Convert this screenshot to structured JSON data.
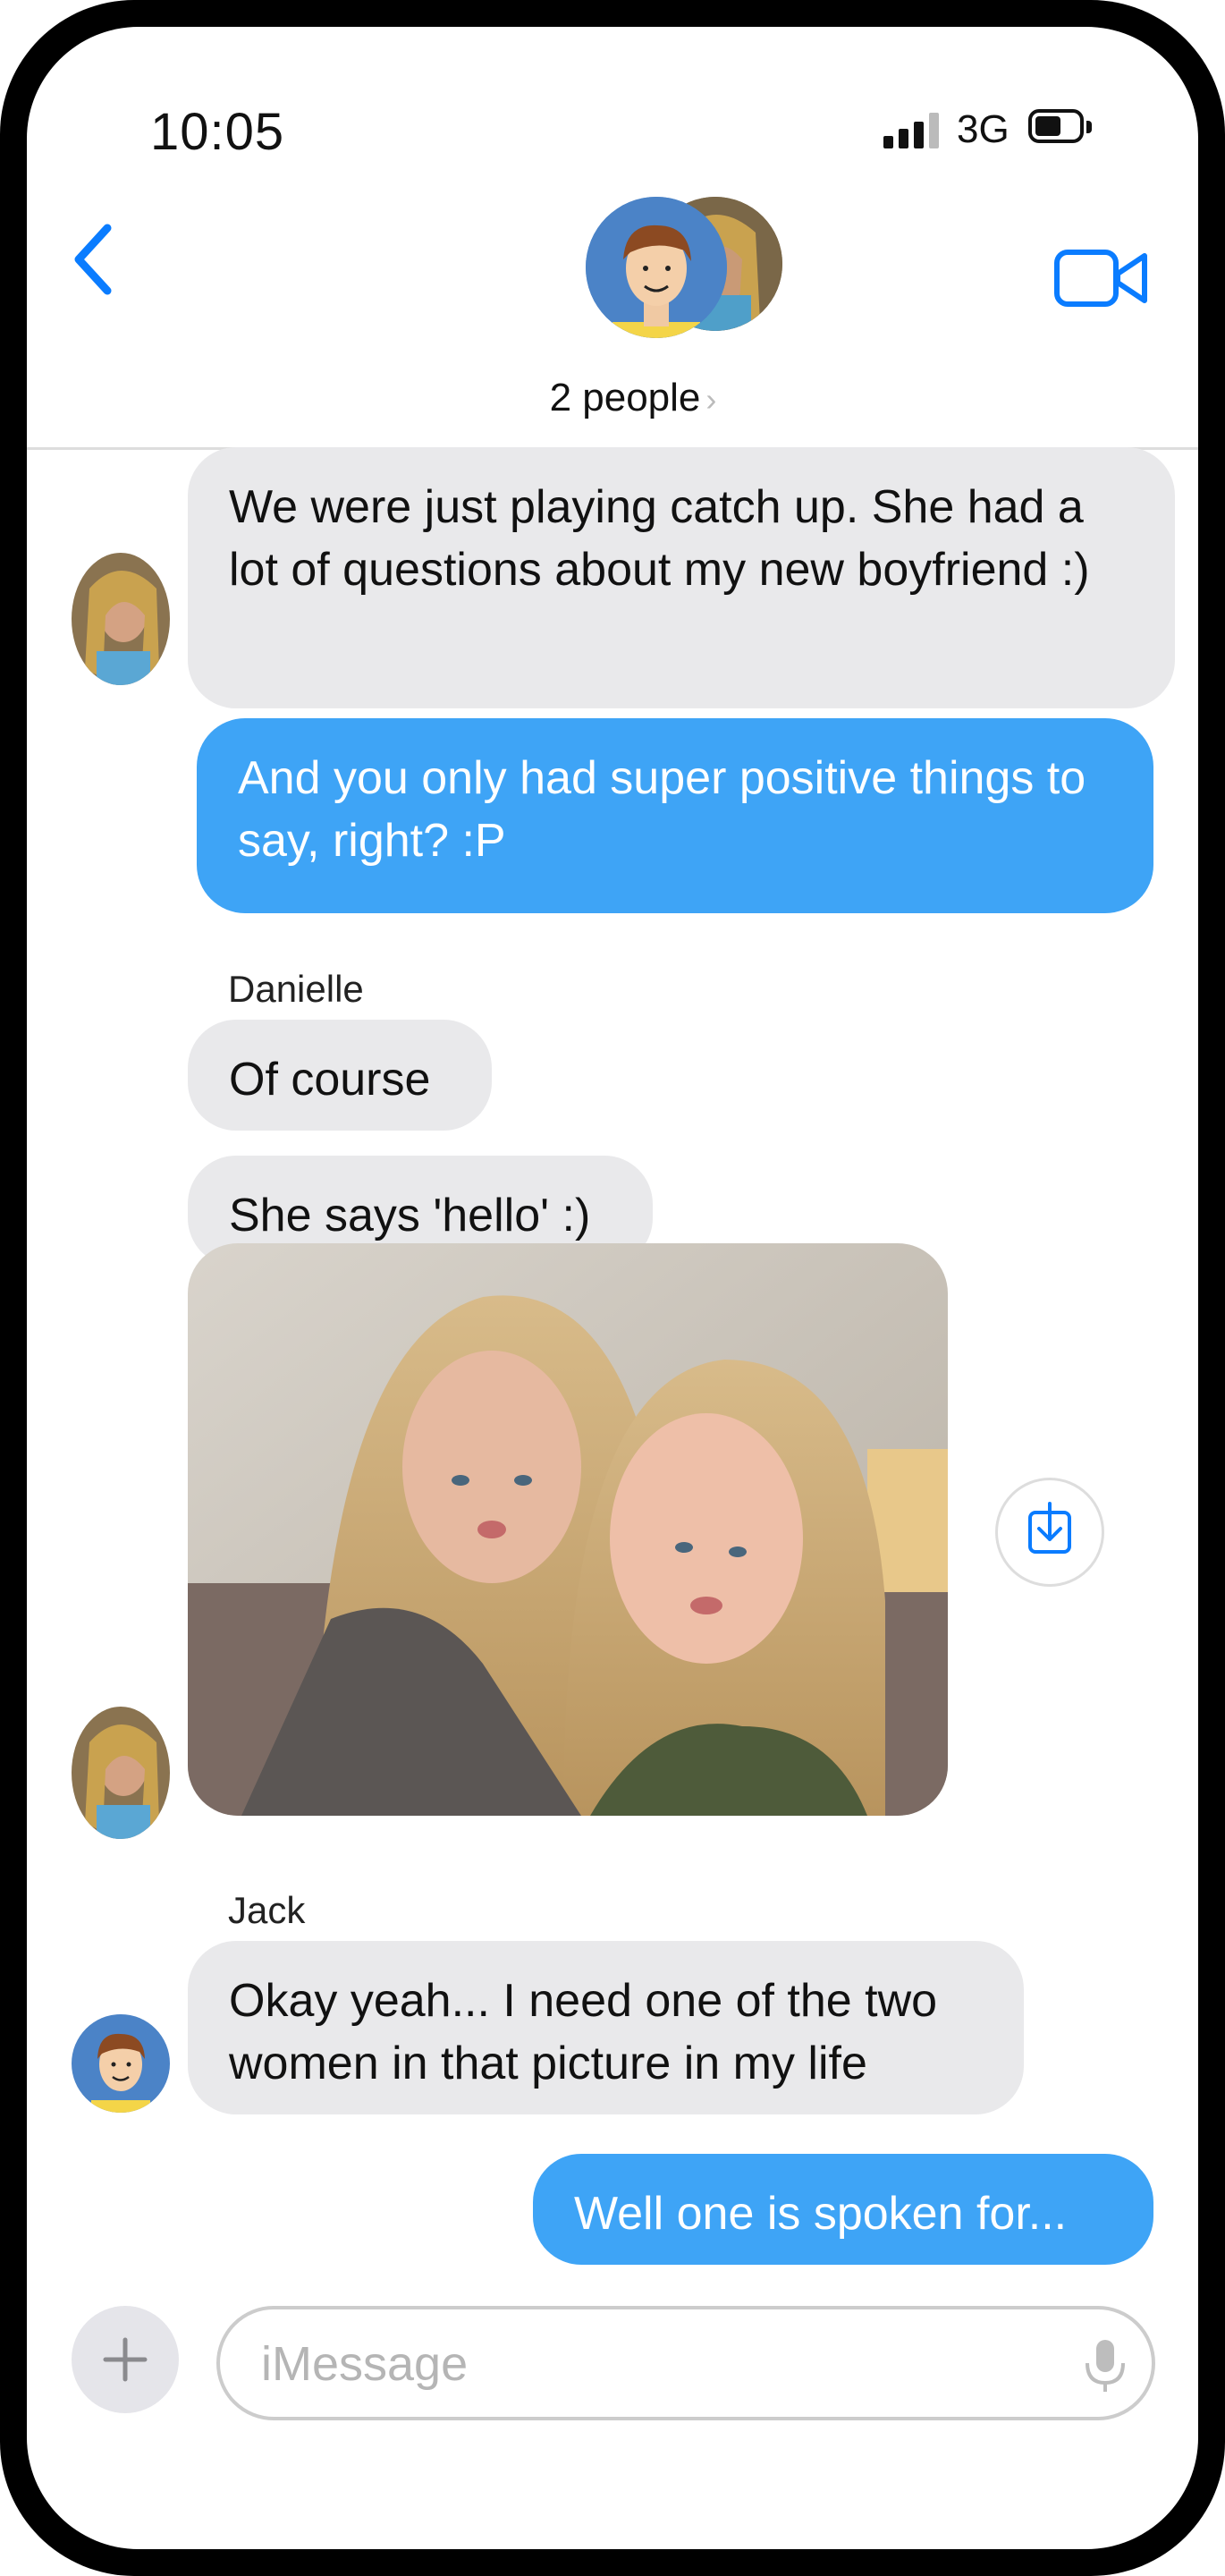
{
  "status": {
    "time": "10:05",
    "network": "3G"
  },
  "header": {
    "people_label": "2 people",
    "chevron": "›"
  },
  "messages": [
    {
      "text": "We were just playing catch up.  She had a lot of questions about my new boyfriend :)"
    },
    {
      "text": "And you only had super positive things to say, right? :P"
    },
    {
      "sender": "Danielle",
      "text": "Of course"
    },
    {
      "text": "She says 'hello' :)"
    },
    {
      "sender": "Jack",
      "text": "Okay yeah... I need one of the two women in that picture in my life"
    },
    {
      "text": "Well one is spoken for..."
    }
  ],
  "composer": {
    "placeholder": "iMessage"
  },
  "colors": {
    "accent": "#0a7cff",
    "outgoing": "#3ea4f6",
    "incoming": "#e9e9eb"
  },
  "icons": [
    "back-chevron-icon",
    "video-camera-icon",
    "save-download-icon",
    "plus-icon",
    "microphone-icon"
  ]
}
